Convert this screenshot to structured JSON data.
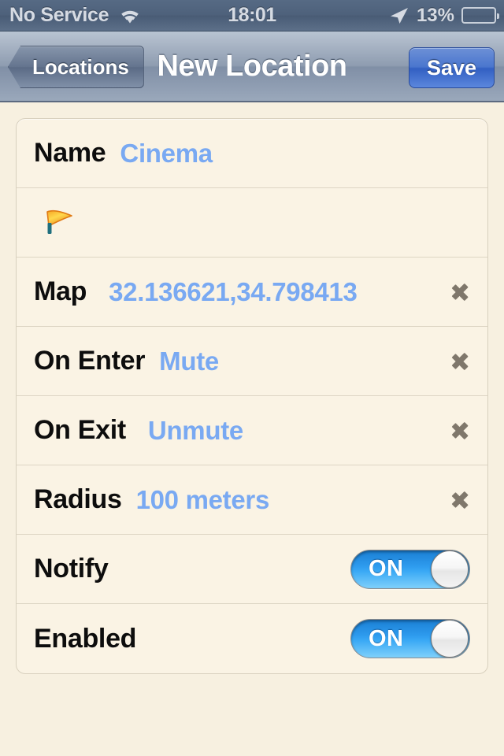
{
  "status_bar": {
    "carrier": "No Service",
    "wifi_icon": "wifi-icon",
    "time": "18:01",
    "location_icon": "location-arrow-icon",
    "battery_percent": "13%",
    "battery_level": 13,
    "battery_color": "#e2352b"
  },
  "nav_bar": {
    "back_label": "Locations",
    "title": "New Location",
    "save_label": "Save"
  },
  "form": {
    "rows": [
      {
        "type": "text",
        "label": "Name",
        "value": "Cinema",
        "name": "row-name"
      },
      {
        "type": "icon",
        "label": "",
        "value": "",
        "icon": "flag-icon",
        "name": "row-flag"
      },
      {
        "type": "disclosure",
        "label": "Map",
        "value": "32.136621,34.798413",
        "name": "row-map"
      },
      {
        "type": "disclosure",
        "label": "On Enter",
        "value": "Mute",
        "name": "row-on-enter"
      },
      {
        "type": "disclosure",
        "label": "On Exit",
        "value": "Unmute",
        "name": "row-on-exit"
      },
      {
        "type": "disclosure",
        "label": "Radius",
        "value": "100 meters",
        "name": "row-radius"
      },
      {
        "type": "switch",
        "label": "Notify",
        "value": "ON",
        "name": "row-notify"
      },
      {
        "type": "switch",
        "label": "Enabled",
        "value": "ON",
        "name": "row-enabled"
      }
    ]
  },
  "colors": {
    "value_blue": "#79a9f2",
    "page_background": "#f7f0e0",
    "cell_background": "#faf3e4",
    "switch_on": "#2e9bee",
    "save_blue": "#4a76ce"
  }
}
